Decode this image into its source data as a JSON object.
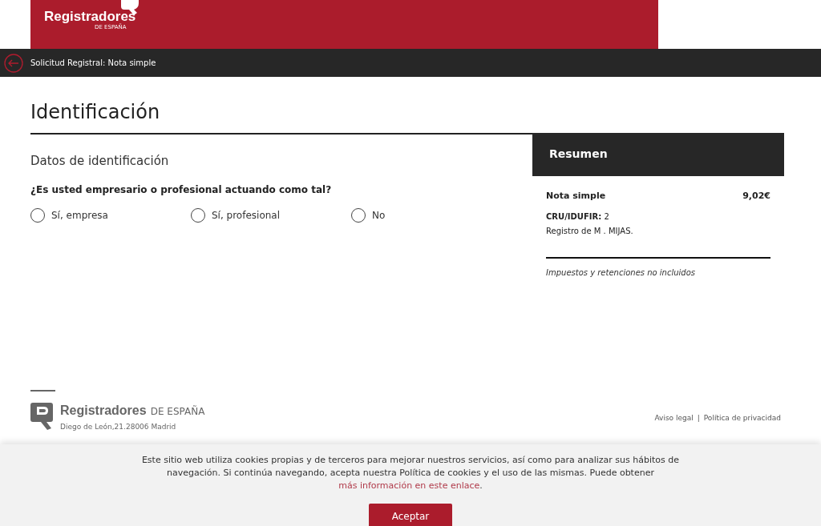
{
  "header": {
    "logo_text": "Registradores",
    "logo_subtext": "DE ESPAÑA"
  },
  "nav_bar": {
    "title": "Solicitud Registral: Nota simple"
  },
  "page_title": "Identificación",
  "form": {
    "section_title": "Datos de identificación",
    "question": "¿Es usted empresario o profesional actuando como tal?",
    "options": [
      {
        "label": "Sí, empresa",
        "selected": false
      },
      {
        "label": "Sí, profesional",
        "selected": false
      },
      {
        "label": "No",
        "selected": false
      }
    ]
  },
  "summary": {
    "title": "Resumen",
    "item": "Nota simple",
    "price": "9,02€",
    "cru_label": "CRU/IDUFIR:",
    "cru_value": "2",
    "registry": "Registro de M . MIJAS.",
    "note": "Impuestos y retenciones no incluidos"
  },
  "footer": {
    "logo_text": "Registradores",
    "logo_subtext": "DE ESPAÑA",
    "address": "Diego de León,21.28006 Madrid",
    "links": [
      "Aviso legal",
      "Política de privacidad"
    ],
    "separator": "|"
  },
  "cookie_banner": {
    "text": "Este sitio web utiliza cookies propias y de terceros para mejorar nuestros servicios, así como para analizar sus hábitos de navegación. Si continúa navegando, acepta nuestra Política de cookies y el uso de las mismas. Puede obtener",
    "link": "más información en este enlace",
    "after_link": ".",
    "button": "Aceptar"
  }
}
